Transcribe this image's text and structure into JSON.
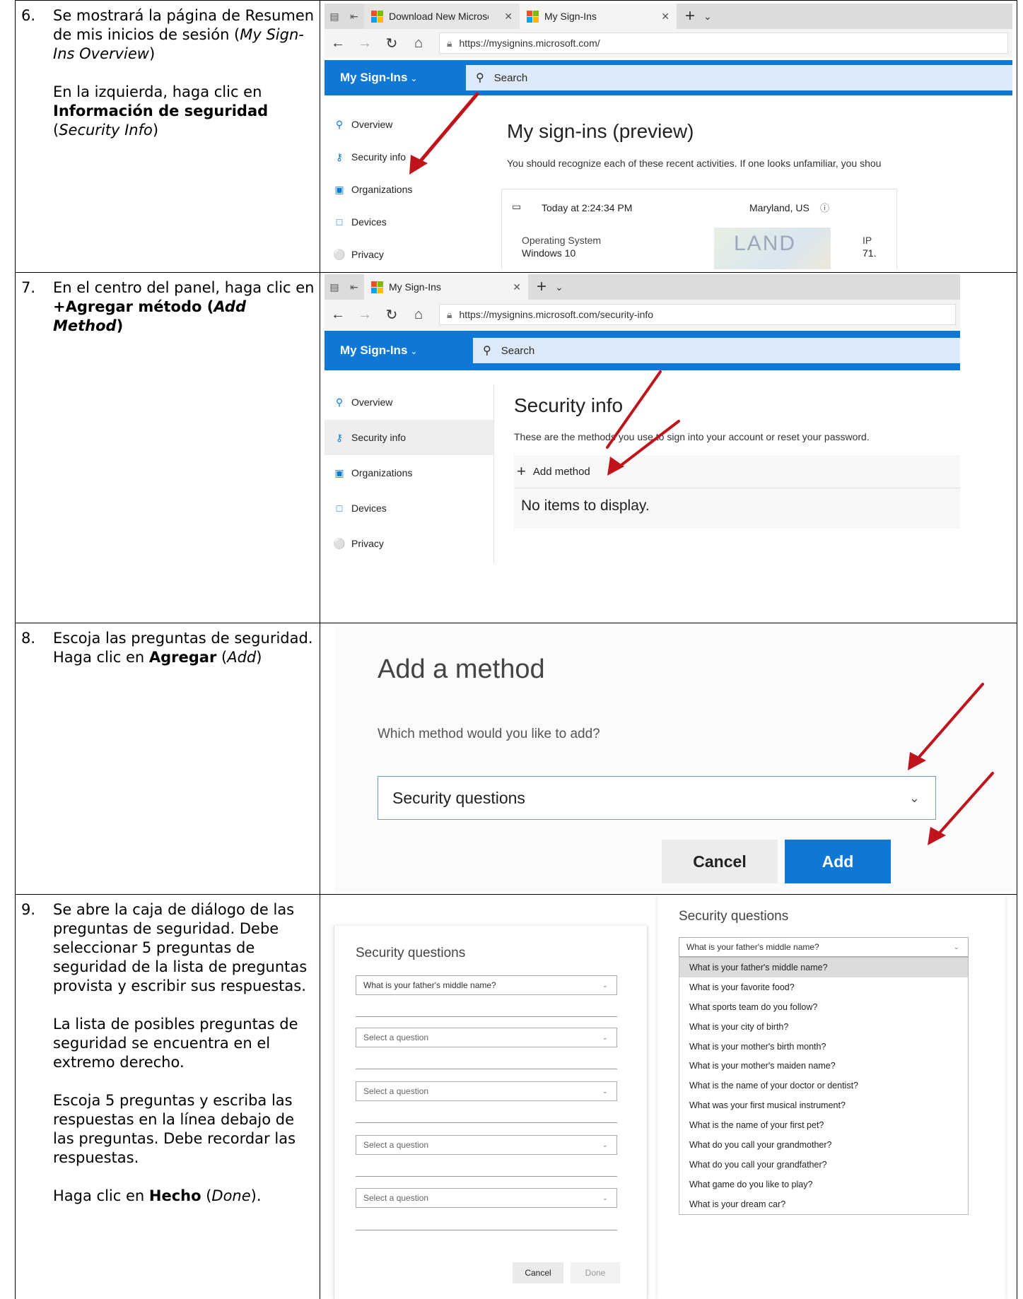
{
  "steps": [
    {
      "number": "6.",
      "para1_a": "Se mostrará la página de Resumen de mis inicios de sesión (",
      "para1_em": "My Sign-Ins Overview",
      "para1_b": ")",
      "para2_a": "En la izquierda, haga clic en ",
      "para2_bold": "Información de seguridad",
      "para2_b": " (",
      "para2_em": "Security Info",
      "para2_c": ")"
    },
    {
      "number": "7.",
      "para1": "En el centro del panel, haga clic en",
      "bold_a": "+Agregar método (",
      "bold_em": "Add Method",
      "bold_b": ")"
    },
    {
      "number": "8.",
      "para1": "Escoja las preguntas de seguridad.",
      "para2_a": "Haga clic en ",
      "para2_bold": "Agregar",
      "para2_b": " (",
      "para2_em": "Add",
      "para2_c": ")"
    },
    {
      "number": "9.",
      "para1": "Se abre la caja de diálogo de las preguntas de seguridad. Debe seleccionar 5 preguntas de seguridad de la lista de preguntas provista y escribir sus respuestas.",
      "para2": "La lista de posibles preguntas de seguridad se encuentra en el extremo derecho.",
      "para3": "Escoja 5 preguntas y escriba las respuestas en la línea debajo de las preguntas. Debe recordar las respuestas.",
      "para4_a": "Haga clic en ",
      "para4_bold": "Hecho",
      "para4_b": " (",
      "para4_em": "Done",
      "para4_c": ")."
    }
  ],
  "shot1": {
    "tab1": "Download New Microsc",
    "tab2": "My Sign-Ins",
    "url": "https://mysignins.microsoft.com/",
    "app_title": "My Sign-Ins",
    "search_placeholder": "Search",
    "nav": [
      "Overview",
      "Security info",
      "Organizations",
      "Devices",
      "Privacy"
    ],
    "page_title": "My sign-ins (preview)",
    "page_sub": "You should recognize each of these recent activities. If one looks unfamiliar, you shou",
    "activity_time": "Today at 2:24:34 PM",
    "activity_location": "Maryland, US",
    "os_label": "Operating System",
    "os_value": "Windows 10",
    "ip_label": "IP",
    "ip_value": "71.",
    "map_text": "LAND"
  },
  "shot2": {
    "tab": "My Sign-Ins",
    "url": "https://mysignins.microsoft.com/security-info",
    "app_title": "My Sign-Ins",
    "search_placeholder": "Search",
    "nav": [
      "Overview",
      "Security info",
      "Organizations",
      "Devices",
      "Privacy"
    ],
    "page_title": "Security info",
    "page_sub": "These are the methods you use to sign into your account or reset your password.",
    "add_method": "Add method",
    "empty_text": "No items to display."
  },
  "shot3": {
    "title": "Add a method",
    "question": "Which method would you like to add?",
    "selected": "Security questions",
    "cancel": "Cancel",
    "add": "Add"
  },
  "shot4": {
    "title": "Security questions",
    "first_selected": "What is your father's middle name?",
    "placeholder": "Select a question",
    "cancel": "Cancel",
    "done": "Done",
    "dropdown_title": "Security questions",
    "dropdown_selected": "What is your father's middle name?",
    "options": [
      "What is your father's middle name?",
      "What is your favorite food?",
      "What sports team do you follow?",
      "What is your city of birth?",
      "What is your mother's birth month?",
      "What is your mother's maiden name?",
      "What is the name of your doctor or dentist?",
      "What was your first musical instrument?",
      "What is the name of your first pet?",
      "What do you call your grandmother?",
      "What do you call your grandfather?",
      "What game do you like to play?",
      "What is your dream car?"
    ]
  },
  "colors": {
    "accent": "#0f78d4",
    "search_bg": "#dbe9f8",
    "arrow": "#c0141c"
  }
}
